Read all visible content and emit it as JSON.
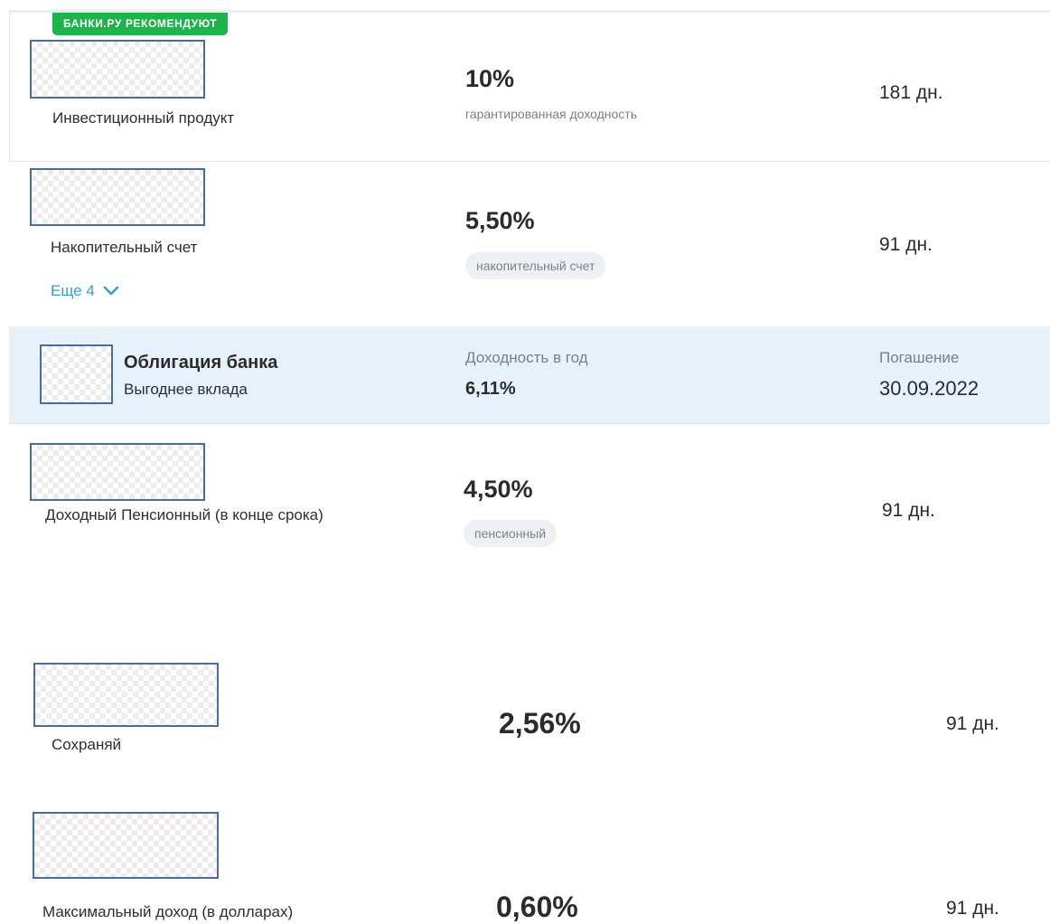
{
  "recommended_badge": "БАНКИ.РУ РЕКОМЕНДУЮТ",
  "products": [
    {
      "name": "Инвестиционный продукт",
      "rate": "10%",
      "rate_caption": "гарантированная доходность",
      "term": "181 дн."
    },
    {
      "name": "Накопительный счет",
      "rate": "5,50%",
      "rate_tag": "накопительный счет",
      "term": "91 дн.",
      "more_label": "Еще 4"
    },
    {
      "name": "Доходный Пенсионный (в конце срока)",
      "rate": "4,50%",
      "rate_tag": "пенсионный",
      "term": "91 дн."
    },
    {
      "name": "Сохраняй",
      "rate": "2,56%",
      "term": "91 дн."
    },
    {
      "name": "Максимальный доход (в долларах)",
      "rate": "0,60%",
      "term": "91 дн."
    }
  ],
  "promo": {
    "title": "Облигация банка",
    "subtitle": "Выгоднее вклада",
    "yield_label": "Доходность в год",
    "yield_value": "6,11%",
    "maturity_label": "Погашение",
    "maturity_date": "30.09.2022"
  },
  "colors": {
    "badge": "#21b34b",
    "link": "#2e9fd6",
    "promo_bg": "#e6f1fb",
    "logo_border": "#4b6d9b"
  }
}
